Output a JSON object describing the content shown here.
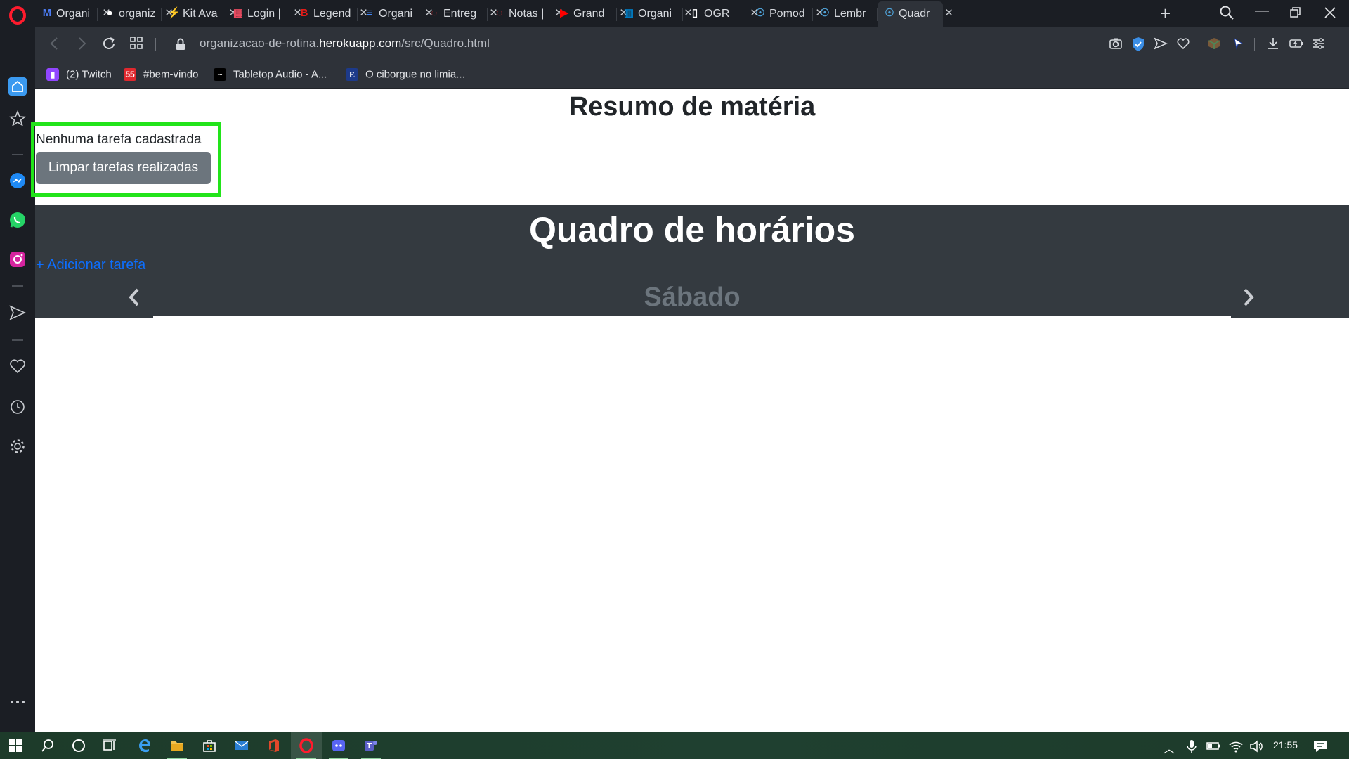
{
  "browser": {
    "tabs": [
      {
        "title": "Organi",
        "icon": "m-app-icon",
        "color": "#4c7cf3"
      },
      {
        "title": "organiz",
        "icon": "github-icon",
        "color": "#ffffff"
      },
      {
        "title": "Kit Ava",
        "icon": "lightning-icon",
        "color": "#f5c400"
      },
      {
        "title": "Login |",
        "icon": "colorful-grid-icon",
        "color": "#e84a5f"
      },
      {
        "title": "Legend",
        "icon": "letter-b-icon",
        "color": "#e41b17"
      },
      {
        "title": "Organi",
        "icon": "docs-icon",
        "color": "#4285f4"
      },
      {
        "title": "Entreg",
        "icon": "red-circle-icon",
        "color": "#e0282e"
      },
      {
        "title": "Notas |",
        "icon": "red-circle-icon",
        "color": "#e0282e"
      },
      {
        "title": "Grand",
        "icon": "youtube-icon",
        "color": "#ff0000"
      },
      {
        "title": "Organi",
        "icon": "trello-icon",
        "color": "#0079bf"
      },
      {
        "title": "OGR",
        "icon": "document-icon",
        "color": "#ffffff"
      },
      {
        "title": "Pomod",
        "icon": "brain-icon",
        "color": "#4fa3d9"
      },
      {
        "title": "Lembr",
        "icon": "brain-icon",
        "color": "#4fa3d9"
      },
      {
        "title": "Quadr",
        "icon": "brain-icon",
        "color": "#4fa3d9",
        "active": true
      }
    ],
    "url": {
      "prefix": "organizacao-de-rotina.",
      "domain": "herokuapp.com",
      "path": "/src/Quadro.html"
    },
    "bookmarks": [
      {
        "label": "(2) Twitch",
        "icon": "twitch-icon",
        "color": "#9146ff"
      },
      {
        "label": "#bem-vindo",
        "icon": "calendar-55-icon",
        "color": "#e0282e"
      },
      {
        "label": "Tabletop Audio - A...",
        "icon": "tabletop-icon",
        "color": "#000000"
      },
      {
        "label": "O ciborgue no limia...",
        "icon": "letter-e-icon",
        "color": "#1d3a8a"
      }
    ]
  },
  "page": {
    "summary_title": "Resumo de matéria",
    "empty_message": "Nenhuma tarefa cadastrada",
    "clear_button": "Limpar tarefas realizadas",
    "schedule_title": "Quadro de horários",
    "add_task_link": "+ Adicionar tarefa",
    "current_day": "Sábado"
  },
  "taskbar": {
    "clock": "21:55"
  },
  "colors": {
    "highlight": "#22e41a",
    "schedule_bg": "#343a40",
    "button_bg": "#6c757d",
    "link": "#0d6efd"
  }
}
